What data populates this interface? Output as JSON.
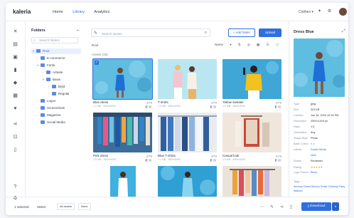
{
  "logo": {
    "text": "kaleria"
  },
  "nav": {
    "items": [
      "Home",
      "Library",
      "Analytics"
    ],
    "active": "Library"
  },
  "workspace": "Clothes",
  "folders_panel": {
    "title": "Folders",
    "search_placeholder": "Search folders",
    "items": [
      {
        "label": "Root",
        "level": 0,
        "selected": true
      },
      {
        "label": "E-commerce",
        "level": 1
      },
      {
        "label": "Fonts",
        "level": 1
      },
      {
        "label": "Arbeite",
        "level": 2
      },
      {
        "label": "Basis",
        "level": 2
      },
      {
        "label": "Bold",
        "level": 3
      },
      {
        "label": "Regular",
        "level": 3
      },
      {
        "label": "Logos",
        "level": 1
      },
      {
        "label": "Screenshots",
        "level": 1
      },
      {
        "label": "Magazine",
        "level": 1
      },
      {
        "label": "Social Media",
        "level": 1
      }
    ]
  },
  "main": {
    "search_placeholder": "Search assets",
    "add_folder_label": "+ Add folder",
    "upload_label": "Upload",
    "breadcrumb": "Root",
    "sort_label": "Name",
    "count_label": "Assets (18)",
    "assets": [
      {
        "name": "Blue dress",
        "type": "jpeg",
        "meta": "1.2 MB · 4000×6000",
        "selected": true,
        "bg": "#5fbde0"
      },
      {
        "name": "T-shirts",
        "type": "jpeg",
        "meta": "1.3 MB · 4000×6000",
        "selected": false,
        "bg": "#b9e6f0"
      },
      {
        "name": "Yellow sweater",
        "type": "jpeg",
        "meta": "1.4 MB · 4000×6000",
        "selected": false,
        "bg": "#3fa6d6"
      },
      {
        "name": "Pink dress",
        "type": "jpeg",
        "meta": "1.5 MB · 4000×6000",
        "selected": false,
        "bg": "#3d6d9a"
      },
      {
        "name": "Blue T-shirts",
        "type": "jpeg",
        "meta": "1.1 MB · 4000×6000",
        "selected": false,
        "bg": "#e8ecf2"
      },
      {
        "name": "Casual look",
        "type": "jpeg",
        "meta": "1.6 MB · 4000×6000",
        "selected": false,
        "bg": "#f0e6dc"
      },
      {
        "name": "",
        "type": "",
        "meta": "",
        "selected": false,
        "bg": "#3fb0df"
      },
      {
        "name": "",
        "type": "",
        "meta": "",
        "selected": false,
        "bg": "#2f9fd4"
      },
      {
        "name": "",
        "type": "",
        "meta": "",
        "selected": false,
        "bg": "#e9e3dc"
      }
    ]
  },
  "details": {
    "title": "Dress Blue",
    "rows": [
      {
        "k": "Type",
        "v": "jpeg"
      },
      {
        "k": "Size",
        "v": "323 KB"
      },
      {
        "k": "Created",
        "v": "Jun 16, 2022 10:16 PM"
      },
      {
        "k": "Resolution",
        "v": "2000×1419 px"
      },
      {
        "k": "Ratio",
        "v": "1.5"
      },
      {
        "k": "Orientation",
        "v": "Any"
      },
      {
        "k": "Image Style",
        "v": "Photo"
      },
      {
        "k": "Base Colors",
        "v": "●  ●"
      },
      {
        "k": "Labels",
        "v": "Social Media",
        "link": true
      },
      {
        "k": "",
        "v": "New",
        "link": true
      },
      {
        "k": "Status",
        "v": "Reviewed"
      },
      {
        "k": "Rating",
        "v": "★★★★★"
      },
      {
        "k": "Logo Parent",
        "v": "Black",
        "link": true
      }
    ],
    "tags_label": "Tags",
    "tags": "Woman  Dress  Blueon  Smile  Clothing  Party  Balloon"
  },
  "bottom": {
    "selected_label": "1 selected",
    "select_label": "Select",
    "all_assets_label": "All assets",
    "none_label": "None",
    "download_label": "Download"
  },
  "colors": {
    "accent": "#2f6fde"
  }
}
